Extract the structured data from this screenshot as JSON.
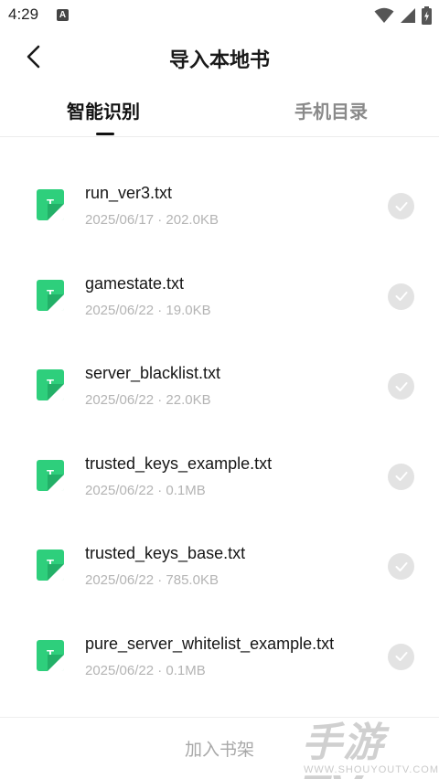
{
  "status_bar": {
    "time": "4:29",
    "notification_badge": "A",
    "icons": [
      "wifi-icon",
      "signal-icon",
      "battery-icon"
    ]
  },
  "header": {
    "back_icon": "chevron-left-icon",
    "title": "导入本地书"
  },
  "tabs": [
    {
      "label": "智能识别",
      "active": true
    },
    {
      "label": "手机目录",
      "active": false
    }
  ],
  "files": [
    {
      "icon_letter": "T",
      "name": "run_ver3.txt",
      "meta": "2025/06/17 · 202.0KB",
      "selected": false
    },
    {
      "icon_letter": "T",
      "name": "gamestate.txt",
      "meta": "2025/06/22 · 19.0KB",
      "selected": false
    },
    {
      "icon_letter": "T",
      "name": "server_blacklist.txt",
      "meta": "2025/06/22 · 22.0KB",
      "selected": false
    },
    {
      "icon_letter": "T",
      "name": "trusted_keys_example.txt",
      "meta": "2025/06/22 · 0.1MB",
      "selected": false
    },
    {
      "icon_letter": "T",
      "name": "trusted_keys_base.txt",
      "meta": "2025/06/22 · 785.0KB",
      "selected": false
    },
    {
      "icon_letter": "T",
      "name": "pure_server_whitelist_example.txt",
      "meta": "2025/06/22 · 0.1MB",
      "selected": false
    }
  ],
  "bottom": {
    "add_label": "加入书架"
  },
  "watermark": {
    "logo": "手游TV",
    "url": "WWW.SHOUYOUTV.COM"
  },
  "colors": {
    "file_icon": "#2ecf7c",
    "check_circle": "#e3e3e3",
    "meta_text": "#b4b4b4",
    "inactive_tab": "#8a8a8a"
  }
}
